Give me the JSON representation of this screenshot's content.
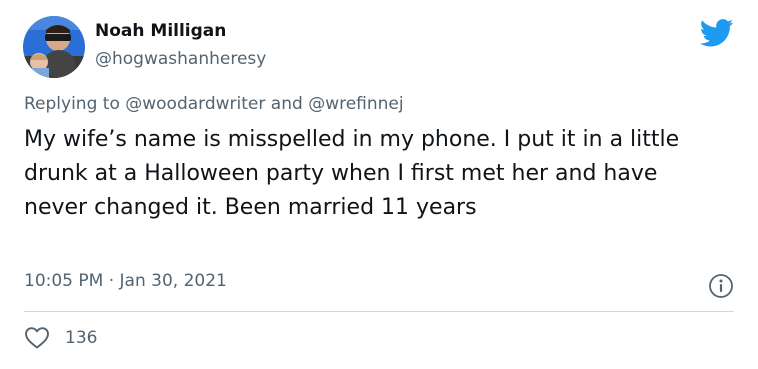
{
  "colors": {
    "brand": "#1d9bf0",
    "text_primary": "#0f1419",
    "text_secondary": "#536471",
    "divider": "#cfd9de"
  },
  "author": {
    "name": "Noah Milligan",
    "handle": "@hogwashanheresy",
    "avatar_icon": "user-avatar"
  },
  "reply_context": {
    "prefix": "Replying to ",
    "mention_1": "@woodardwriter",
    "joiner": " and ",
    "mention_2": "@wrefinnej"
  },
  "tweet": {
    "text": "My wife’s name is misspelled in my phone. I put it in a little drunk at a Halloween party when I first met her and have never changed it. Been married 11 years",
    "time": "10:05 PM",
    "separator": " · ",
    "date": "Jan 30, 2021"
  },
  "engagement": {
    "like_icon": "heart-icon",
    "like_count": "136"
  },
  "icons": {
    "brand": "twitter-bird-icon",
    "info": "info-icon"
  }
}
